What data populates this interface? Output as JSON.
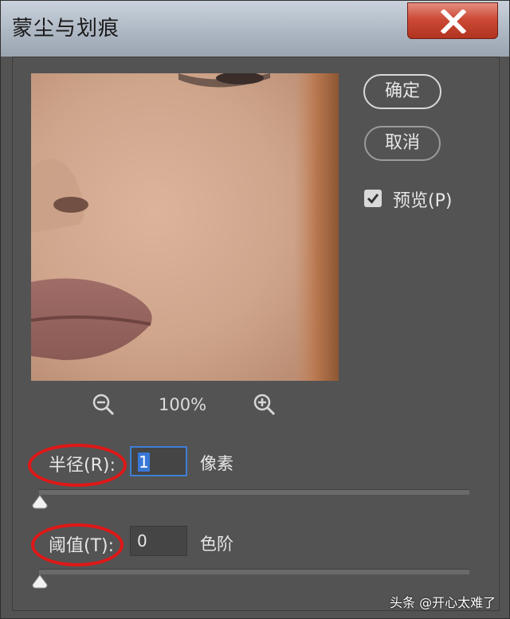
{
  "window": {
    "title": "蒙尘与划痕",
    "close_icon": "close-icon"
  },
  "buttons": {
    "ok_label": "确定",
    "cancel_label": "取消"
  },
  "preview": {
    "checkbox_checked": true,
    "checkbox_label": "预览(P)",
    "zoom_level": "100%",
    "zoom_out_icon": "zoom-out-icon",
    "zoom_in_icon": "zoom-in-icon"
  },
  "radius": {
    "label": "半径(R):",
    "value": "1",
    "unit": "像素",
    "slider_value": 1
  },
  "threshold": {
    "label": "阈值(T):",
    "value": "0",
    "unit": "色阶",
    "slider_value": 0
  },
  "annotations": {
    "highlight_color": "#e01818"
  },
  "watermark": {
    "text": "头条 @开心太难了"
  }
}
